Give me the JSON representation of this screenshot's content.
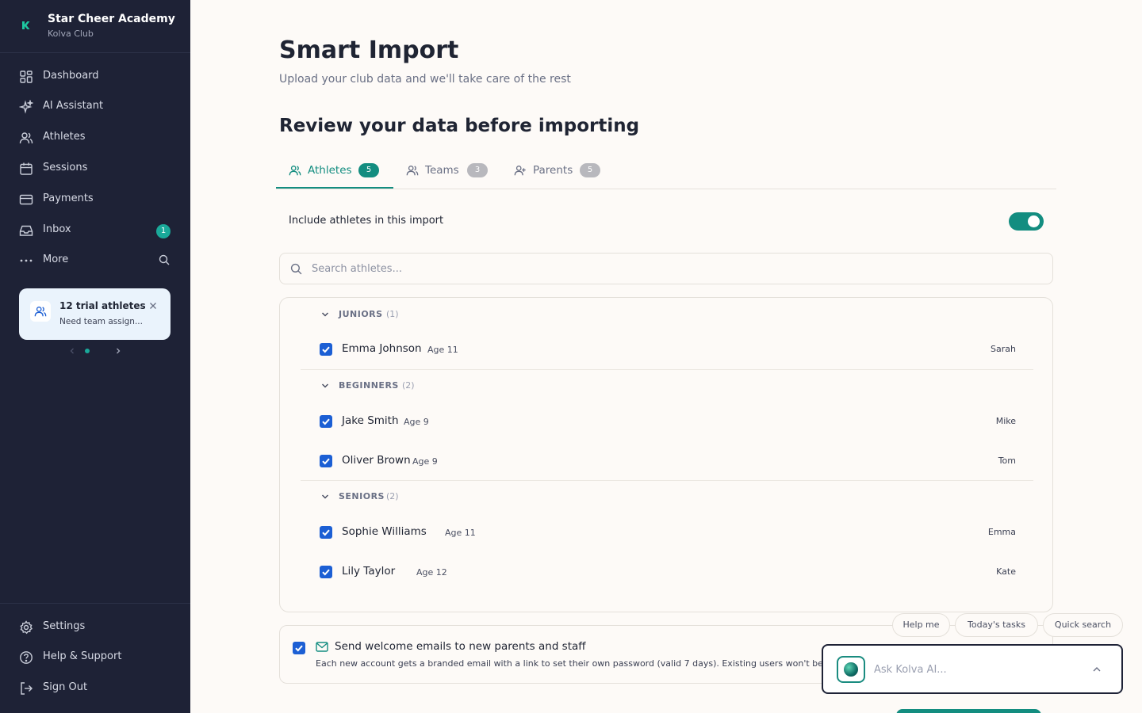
{
  "brand": {
    "name": "Star Cheer Academy",
    "subtitle": "Kolva Club"
  },
  "sidebar": {
    "items": [
      {
        "label": "Dashboard",
        "icon": "dashboard-grid-icon"
      },
      {
        "label": "AI Assistant",
        "icon": "sparkles-icon"
      },
      {
        "label": "Athletes",
        "icon": "users-icon"
      },
      {
        "label": "Sessions",
        "icon": "calendar-icon"
      },
      {
        "label": "Payments",
        "icon": "credit-card-icon"
      },
      {
        "label": "Inbox",
        "icon": "inbox-icon",
        "badge": "1"
      },
      {
        "label": "More",
        "icon": "more-dots-icon"
      }
    ],
    "bottom_items": [
      {
        "label": "Settings",
        "icon": "gear-icon"
      },
      {
        "label": "Help & Support",
        "icon": "help-circle-icon"
      },
      {
        "label": "Sign Out",
        "icon": "sign-out-icon"
      }
    ],
    "trial_card": {
      "title": "12 trial athletes",
      "subtitle": "Need team assign..."
    }
  },
  "page": {
    "title": "Smart Import",
    "subtitle": "Upload your club data and we'll take care of the rest",
    "section_title": "Review your data before importing"
  },
  "tabs": [
    {
      "label": "Athletes",
      "count": "5",
      "active": true
    },
    {
      "label": "Teams",
      "count": "3",
      "active": false
    },
    {
      "label": "Parents",
      "count": "5",
      "active": false
    }
  ],
  "include_label": "Include athletes in this import",
  "include_enabled": true,
  "search": {
    "placeholder": "Search athletes..."
  },
  "groups": [
    {
      "name": "JUNIORS",
      "count": "(1)",
      "athletes": [
        {
          "name": "Emma Johnson",
          "age": "Age 11",
          "coach": "Sarah",
          "checked": true
        }
      ]
    },
    {
      "name": "BEGINNERS",
      "count": "(2)",
      "athletes": [
        {
          "name": "Jake Smith",
          "age": "Age 9",
          "coach": "Mike",
          "checked": true
        },
        {
          "name": "Oliver Brown",
          "age": "Age 9",
          "coach": "Tom",
          "checked": true
        }
      ]
    },
    {
      "name": "SENIORS",
      "count": "(2)",
      "athletes": [
        {
          "name": "Sophie Williams",
          "age": "Age 11",
          "coach": "Emma",
          "checked": true
        },
        {
          "name": "Lily Taylor",
          "age": "Age 12",
          "coach": "Kate",
          "checked": true
        }
      ]
    }
  ],
  "welcome": {
    "title": "Send welcome emails to new parents and staff",
    "description": "Each new account gets a branded email with a link to set their own password (valid 7 days). Existing users won't be e",
    "checked": true
  },
  "quick_chips": [
    "Help me",
    "Today's tasks",
    "Quick search"
  ],
  "ai": {
    "placeholder": "Ask Kolva AI..."
  },
  "colors": {
    "sidebar": "#1e2236",
    "accent": "#138d80",
    "checkbox": "#1c5fd4",
    "badge": "#1aa99a"
  }
}
